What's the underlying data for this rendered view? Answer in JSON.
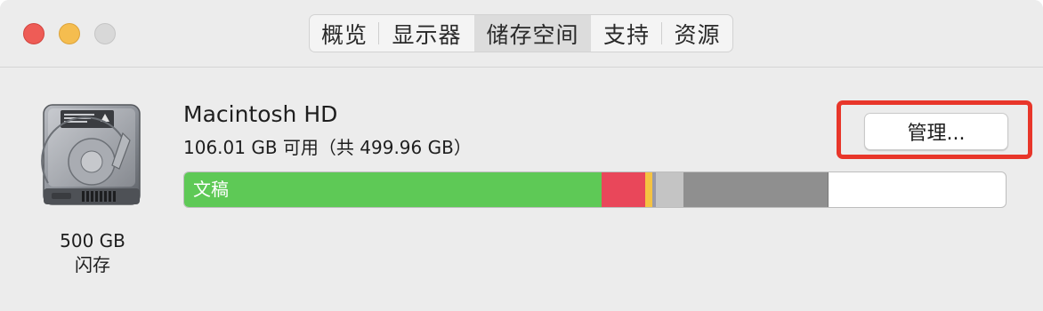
{
  "tabs": {
    "overview": "概览",
    "displays": "显示器",
    "storage": "储存空间",
    "support": "支持",
    "resources": "资源"
  },
  "disk": {
    "capacity": "500 GB",
    "type": "闪存"
  },
  "volume": {
    "name": "Macintosh HD",
    "info": "106.01 GB 可用（共 499.96 GB）",
    "manage_label": "管理..."
  },
  "storage_bar": {
    "segments": [
      {
        "name": "文稿",
        "color": "#5ec956",
        "fraction": 0.5086
      },
      {
        "name": "",
        "color": "#e9475a",
        "fraction": 0.0531
      },
      {
        "name": "",
        "color": "#f5c242",
        "fraction": 0.0087
      },
      {
        "name": "",
        "color": "#9a9aa8",
        "fraction": 0.0033
      },
      {
        "name": "",
        "color": "#c4c4c4",
        "fraction": 0.0336
      },
      {
        "name": "",
        "color": "#8f8f8f",
        "fraction": 0.1768
      }
    ]
  },
  "colors": {
    "highlight_outline": "#e8362a",
    "window_bg": "#ececec"
  }
}
